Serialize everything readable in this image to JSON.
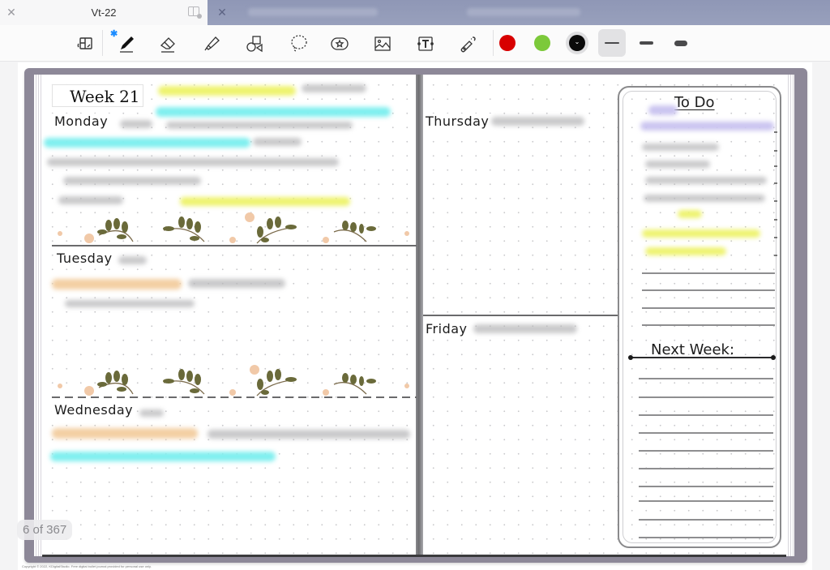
{
  "tabs": [
    {
      "title": "Vt-22",
      "active": true,
      "close_icon": "close-icon",
      "split_icon": "split-view-icon"
    },
    {
      "title": "",
      "active": false,
      "close_icon": "close-icon"
    }
  ],
  "toolbar": {
    "tools": [
      {
        "name": "page-view-tool",
        "icon": "page-thumbnail-icon"
      },
      {
        "name": "pen-tool",
        "icon": "pen-icon",
        "selected": true,
        "badge": "bluetooth-icon"
      },
      {
        "name": "eraser-tool",
        "icon": "eraser-icon"
      },
      {
        "name": "highlighter-tool",
        "icon": "highlighter-icon"
      },
      {
        "name": "shapes-tool",
        "icon": "shapes-icon"
      },
      {
        "name": "lasso-tool",
        "icon": "lasso-icon"
      },
      {
        "name": "sticker-tool",
        "icon": "star-sticker-icon"
      },
      {
        "name": "image-tool",
        "icon": "image-icon"
      },
      {
        "name": "text-tool",
        "icon": "text-box-icon"
      },
      {
        "name": "laser-pointer-tool",
        "icon": "laser-pointer-icon"
      }
    ],
    "bluetooth_glyph": "✱",
    "colors": [
      {
        "name": "red",
        "hex": "#d80000"
      },
      {
        "name": "green",
        "hex": "#7cc93a"
      },
      {
        "name": "black",
        "hex": "#0a0a0a",
        "selected": true
      }
    ],
    "strokes": [
      {
        "name": "thin",
        "selected": true
      },
      {
        "name": "medium",
        "selected": false
      },
      {
        "name": "thick",
        "selected": false
      }
    ]
  },
  "planner": {
    "week_label": "Week 21",
    "days_left": [
      "Monday",
      "Tuesday",
      "Wednesday"
    ],
    "days_right": [
      "Thursday",
      "Friday"
    ],
    "todo_title": "To Do",
    "next_week_title": "Next Week:",
    "copyright": "Copyright © 2022, KDigitalStudio. Free digital bullet journal provided for personal use only."
  },
  "page_indicator": {
    "current": 6,
    "total": 367,
    "text": "6 of 367"
  },
  "colors": {
    "book_cover": "#8d8898",
    "highlight_yellow": "#eef36f",
    "highlight_cyan": "#7fefef",
    "highlight_peach": "#f3cfa3",
    "highlight_purple": "#cac4f0"
  }
}
